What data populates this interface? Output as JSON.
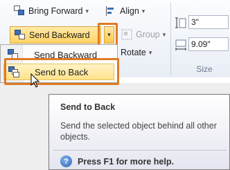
{
  "ribbon": {
    "bring_forward": "Bring Forward",
    "send_backward": "Send Backward",
    "align": "Align",
    "group": "Group",
    "rotate": "Rotate",
    "split_arrow_glyph": "▾",
    "dropdown_glyph": "▾"
  },
  "size": {
    "height_value": "3\"",
    "width_value": "9.09\"",
    "group_label": "Size"
  },
  "menu": {
    "items": [
      {
        "label": "Send Backward",
        "underline_char": "B"
      },
      {
        "label": "Send to Back",
        "underline_char": "k"
      }
    ]
  },
  "tooltip": {
    "title": "Send to Back",
    "description": "Send the selected object behind all other objects.",
    "help": "Press F1 for more help.",
    "help_icon_glyph": "?"
  },
  "colors": {
    "highlight_outline": "#e07a22",
    "button_hover": "#ffd467",
    "menu_hover": "#ffe28a",
    "help_icon": "#2f67b4"
  },
  "icons": {
    "bring_forward": "bring-forward-icon",
    "send_backward": "send-backward-icon",
    "align": "align-icon",
    "group": "group-icon",
    "height": "shape-height-icon",
    "width": "shape-width-icon",
    "send_to_back": "send-to-back-icon",
    "help": "help-icon",
    "cursor": "mouse-pointer-icon"
  }
}
